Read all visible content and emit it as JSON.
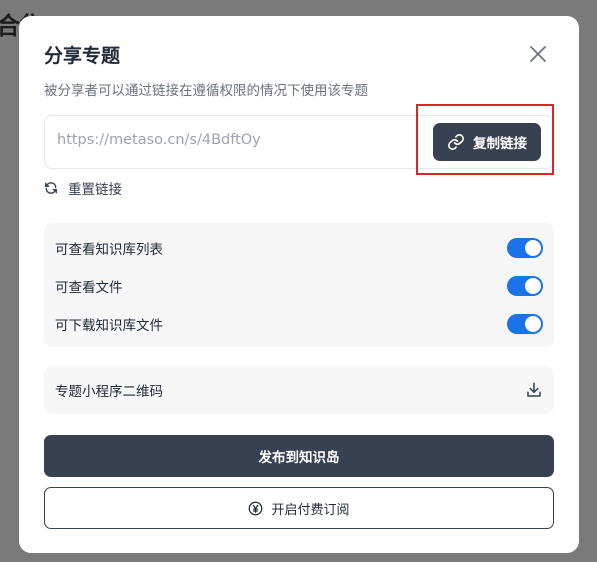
{
  "background": {
    "title_fragment": "合集"
  },
  "modal": {
    "title": "分享专题",
    "subtitle": "被分享者可以通过链接在遵循权限的情况下使用该专题",
    "share_link": "https://metaso.cn/s/4BdftOy",
    "copy_button": "复制链接",
    "reset_link": "重置链接",
    "permissions": [
      {
        "label": "可查看知识库列表",
        "enabled": true
      },
      {
        "label": "可查看文件",
        "enabled": true
      },
      {
        "label": "可下载知识库文件",
        "enabled": true
      }
    ],
    "qr_code_label": "专题小程序二维码",
    "publish_button": "发布到知识岛",
    "subscribe_button": "开启付费订阅"
  },
  "colors": {
    "primary_dark": "#374151",
    "toggle_on": "#1a73e8",
    "highlight": "#e02424",
    "overlay": "#7a7a7a"
  },
  "icons": {
    "close": "close-icon",
    "copy": "link-icon",
    "reset": "refresh-icon",
    "download": "download-icon",
    "subscribe": "yen-coin-icon"
  }
}
